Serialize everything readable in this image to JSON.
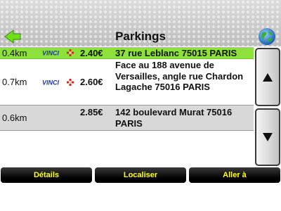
{
  "header": {
    "title": "Parkings",
    "back_icon": "back-arrow-icon",
    "globe_icon": "globe-icon"
  },
  "rows": [
    {
      "distance": "0.4km",
      "operator": "VINCI",
      "price": "2.40€",
      "address": "37 rue Leblanc 75015 PARIS",
      "selected": true
    },
    {
      "distance": "0.7km",
      "operator": "VINCI",
      "price": "2.60€",
      "address": "Face au 188 avenue de Versailles, angle rue Chardon Lagache 75016 PARIS",
      "selected": false
    },
    {
      "distance": "0.6km",
      "operator": "",
      "price": "2.85€",
      "address": "142 boulevard Murat 75016 PARIS",
      "selected": false
    }
  ],
  "scroll": {
    "up_icon": "arrow-up-icon",
    "down_icon": "arrow-down-icon"
  },
  "actions": {
    "details": "Détails",
    "locate": "Localiser",
    "goto": "Aller à"
  },
  "colors": {
    "selected_row": "#8ee03b",
    "alt_row": "#d8d8d8",
    "button_text": "#ffff1a",
    "vinci_blue": "#1a3a9e",
    "vinci_red": "#e02020"
  }
}
